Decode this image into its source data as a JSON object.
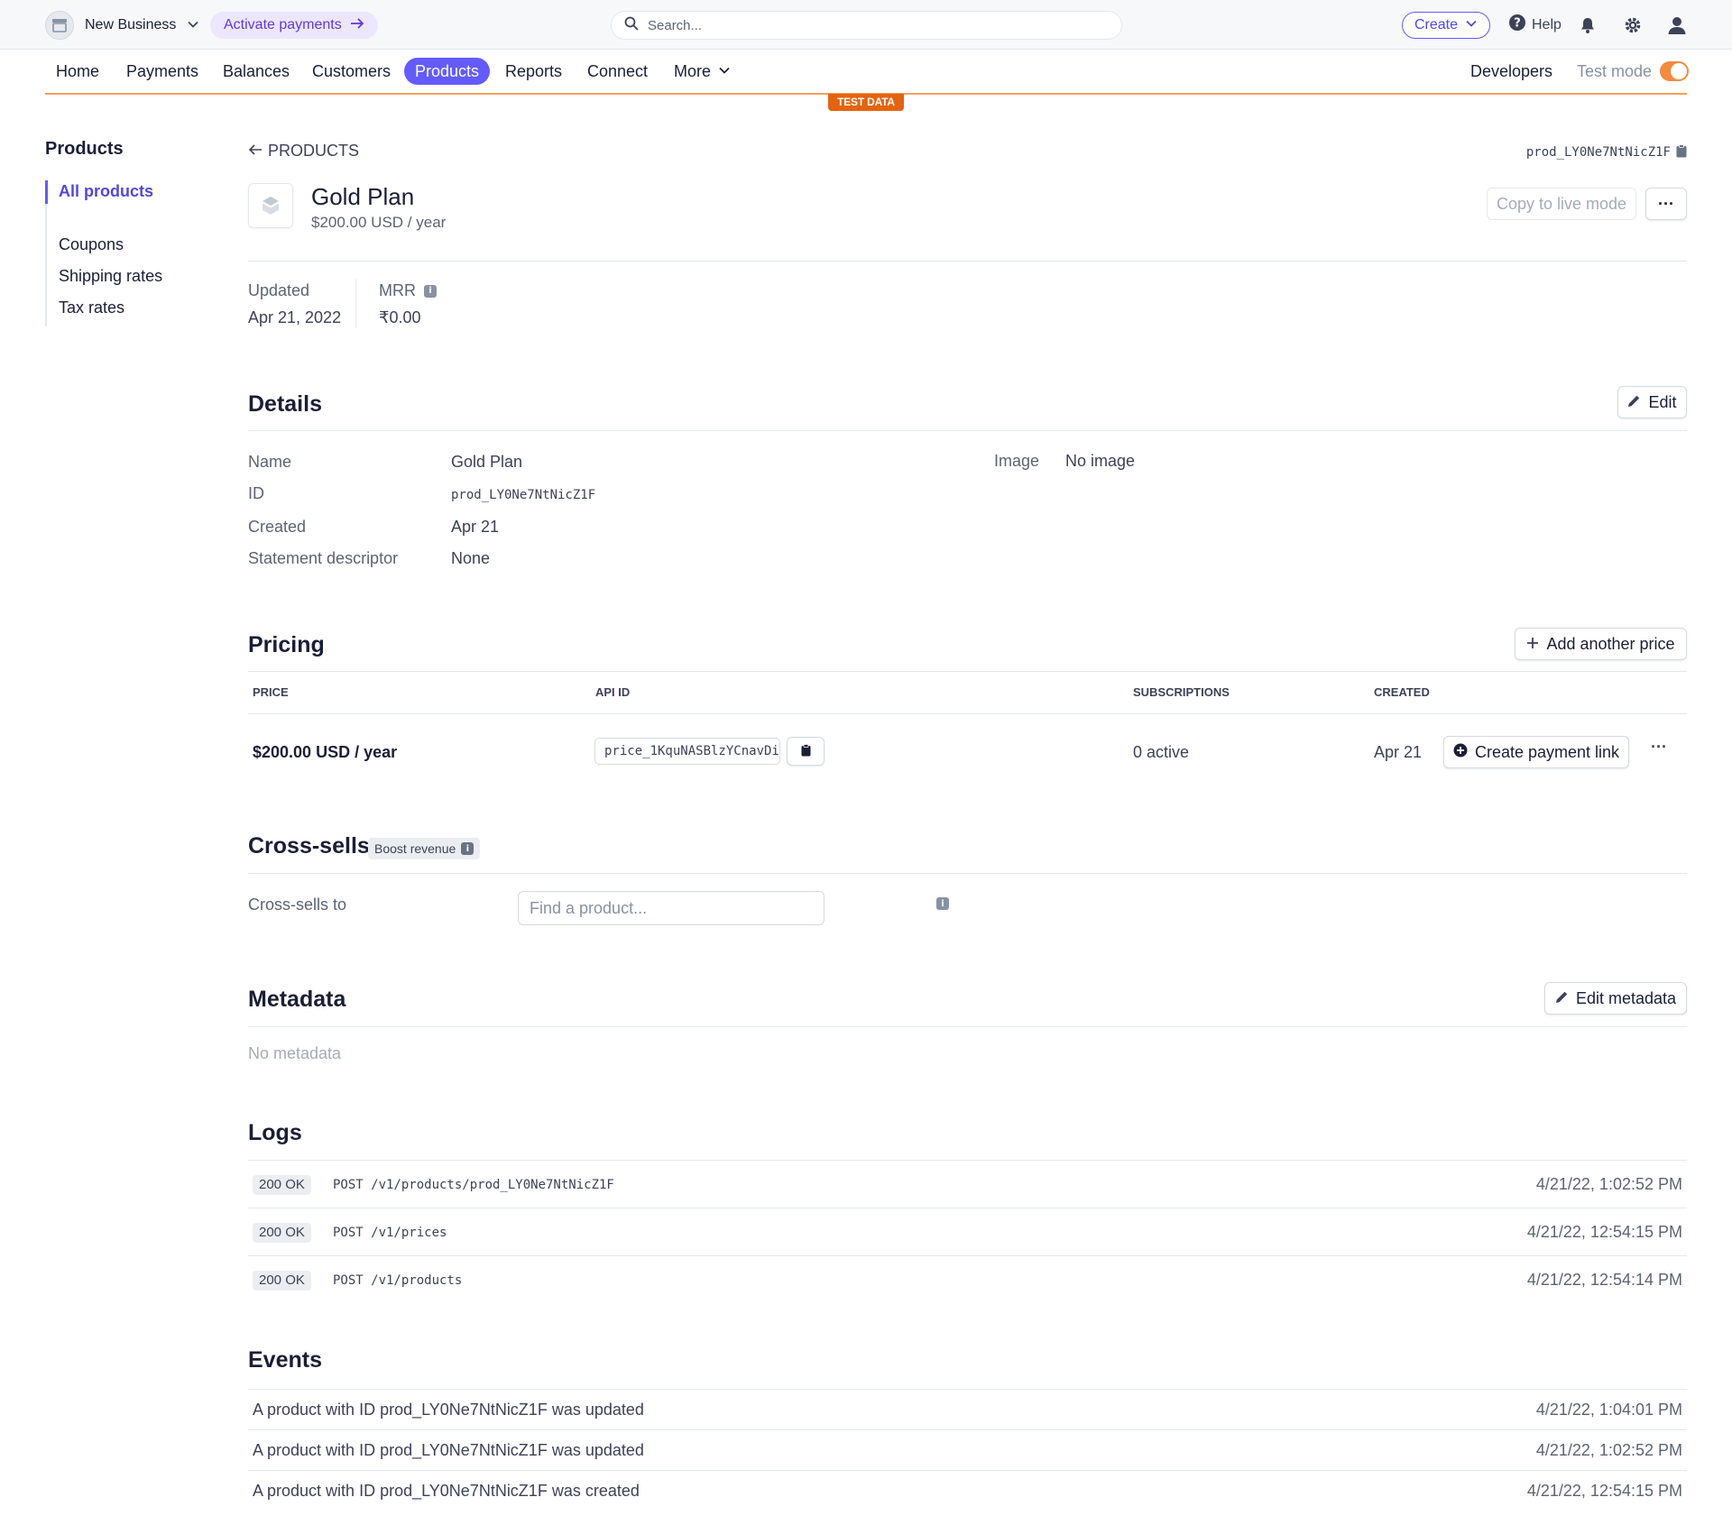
{
  "topbar": {
    "business_name": "New Business",
    "activate_label": "Activate payments",
    "search_placeholder": "Search...",
    "create_label": "Create",
    "help_label": "Help"
  },
  "nav": {
    "items": [
      "Home",
      "Payments",
      "Balances",
      "Customers",
      "Products",
      "Reports",
      "Connect",
      "More"
    ],
    "active": "Products",
    "developers_label": "Developers",
    "test_mode_label": "Test mode",
    "test_mode_on": true,
    "test_data_badge": "TEST DATA"
  },
  "sidebar": {
    "title": "Products",
    "items": [
      "All products",
      "Coupons",
      "Shipping rates",
      "Tax rates"
    ],
    "active": "All products"
  },
  "product": {
    "back_label": "PRODUCTS",
    "id": "prod_LY0Ne7NtNicZ1F",
    "name": "Gold Plan",
    "price_summary": "$200.00 USD / year",
    "copy_to_live_label": "Copy to live mode",
    "more_label": "···"
  },
  "stats": {
    "updated_label": "Updated",
    "updated_value": "Apr 21, 2022",
    "mrr_label": "MRR",
    "mrr_value": "₹0.00"
  },
  "details": {
    "title": "Details",
    "edit_label": "Edit",
    "name_label": "Name",
    "name_value": "Gold Plan",
    "id_label": "ID",
    "id_value": "prod_LY0Ne7NtNicZ1F",
    "created_label": "Created",
    "created_value": "Apr 21",
    "descriptor_label": "Statement descriptor",
    "descriptor_value": "None",
    "image_label": "Image",
    "image_value": "No image"
  },
  "pricing": {
    "title": "Pricing",
    "add_label": "Add another price",
    "columns": [
      "PRICE",
      "API ID",
      "SUBSCRIPTIONS",
      "CREATED"
    ],
    "row": {
      "price": "$200.00 USD / year",
      "api_id": "price_1KquNASBlzYCnavDi",
      "subscriptions": "0 active",
      "created": "Apr 21",
      "payment_link_label": "Create payment link",
      "more_label": "···"
    }
  },
  "crosssells": {
    "title": "Cross-sells",
    "badge": "Boost revenue",
    "label": "Cross-sells to",
    "placeholder": "Find a product..."
  },
  "metadata": {
    "title": "Metadata",
    "edit_label": "Edit metadata",
    "empty": "No metadata"
  },
  "logs": {
    "title": "Logs",
    "rows": [
      {
        "status": "200 OK",
        "request": "POST /v1/products/prod_LY0Ne7NtNicZ1F",
        "time": "4/21/22, 1:02:52 PM"
      },
      {
        "status": "200 OK",
        "request": "POST /v1/prices",
        "time": "4/21/22, 12:54:15 PM"
      },
      {
        "status": "200 OK",
        "request": "POST /v1/products",
        "time": "4/21/22, 12:54:14 PM"
      }
    ]
  },
  "events": {
    "title": "Events",
    "rows": [
      {
        "text": "A product with ID prod_LY0Ne7NtNicZ1F was updated",
        "time": "4/21/22, 1:04:01 PM"
      },
      {
        "text": "A product with ID prod_LY0Ne7NtNicZ1F was updated",
        "time": "4/21/22, 1:02:52 PM"
      },
      {
        "text": "A product with ID prod_LY0Ne7NtNicZ1F was created",
        "time": "4/21/22, 12:54:15 PM"
      }
    ]
  },
  "colors": {
    "accent": "#635bff",
    "test_mode": "#f28b3c",
    "test_badge": "#e5630f"
  }
}
